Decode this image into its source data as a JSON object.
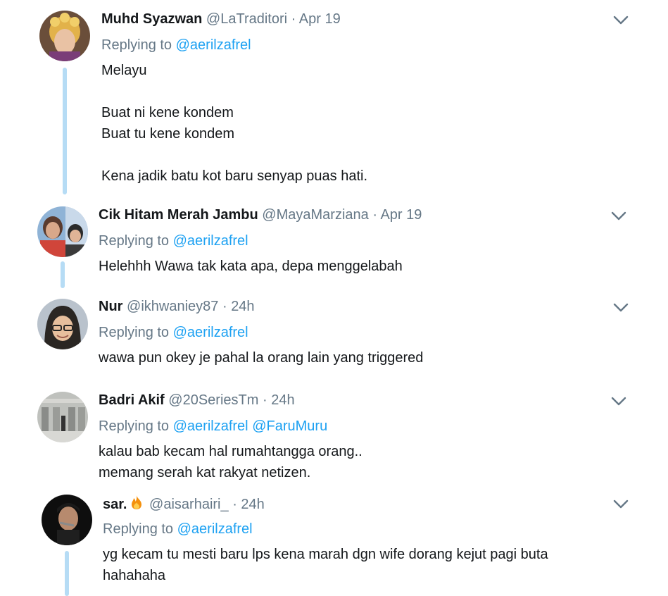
{
  "tweets": [
    {
      "name": "Muhd Syazwan",
      "handle": "@LaTraditori",
      "dot": "·",
      "time": "Apr 19",
      "replying_prefix": "Replying to",
      "mentions": [
        "@aerilzafrel"
      ],
      "text": "Melayu\n\nBuat ni kene kondem\nBuat tu kene kondem\n\nKena jadik batu kot baru senyap puas hati."
    },
    {
      "name": "Cik Hitam Merah Jambu",
      "handle": "@MayaMarziana",
      "dot": "·",
      "time": "Apr 19",
      "replying_prefix": "Replying to",
      "mentions": [
        "@aerilzafrel"
      ],
      "text": "Helehhh Wawa tak kata apa, depa menggelabah"
    },
    {
      "name": "Nur",
      "handle": "@ikhwaniey87",
      "dot": "·",
      "time": "24h",
      "replying_prefix": "Replying to",
      "mentions": [
        "@aerilzafrel"
      ],
      "text": "wawa pun okey je pahal la orang lain yang triggered"
    },
    {
      "name": "Badri Akif",
      "handle": "@20SeriesTm",
      "dot": "·",
      "time": "24h",
      "replying_prefix": "Replying to",
      "mentions": [
        "@aerilzafrel",
        "@FaruMuru"
      ],
      "text": "kalau bab kecam hal rumahtangga orang..\nmemang serah kat rakyat netizen."
    },
    {
      "name": "sar.",
      "handle": "@aisarhairi_",
      "dot": "·",
      "time": "24h",
      "replying_prefix": "Replying to",
      "mentions": [
        "@aerilzafrel"
      ],
      "text": "yg kecam tu mesti baru lps kena marah dgn wife dorang kejut pagi buta\nhahahaha"
    }
  ],
  "icons": {
    "more": "chevron-down-icon",
    "emoji": "fire-emoji-icon"
  },
  "colors": {
    "link": "#1da1f2",
    "secondary": "#657786",
    "text": "#14171a",
    "thread_line": "#b6dcf5"
  }
}
